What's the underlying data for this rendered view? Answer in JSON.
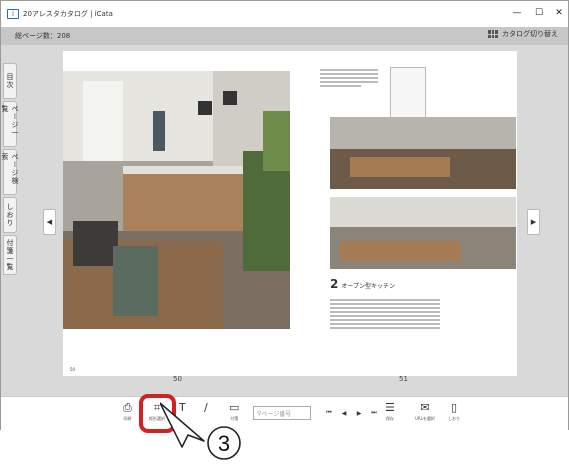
{
  "window": {
    "title": "20アレスタカタログ | iCata",
    "minimize": "—",
    "maximize": "☐",
    "close": "✕"
  },
  "infobar": {
    "total_pages": "総ページ数：208",
    "catalog_switch": "カタログ切り替え"
  },
  "sidetabs": [
    "目次",
    "ページ一覧",
    "ページ検索",
    "しおり",
    "付箋一覧"
  ],
  "nav": {
    "prev": "◀",
    "next": "▶"
  },
  "pages": {
    "left_number": "50",
    "right_number": "51"
  },
  "right_page": {
    "catchphrase": "オープン型キッチン",
    "plan_number": "2"
  },
  "toolbar": {
    "print": "印刷",
    "box_select": "矩形選択",
    "text": "",
    "pen": "",
    "note": "付箋",
    "search_placeholder": "ページ番号",
    "first": "⏮",
    "prev": "◀",
    "next": "▶",
    "last": "⏭",
    "save": "保存",
    "catalog_select": "URLを選択",
    "bookmark": "しおり"
  },
  "callout": {
    "step": "3"
  },
  "colors": {
    "highlight": "#d32020",
    "infobar": "#c7c7c7"
  }
}
